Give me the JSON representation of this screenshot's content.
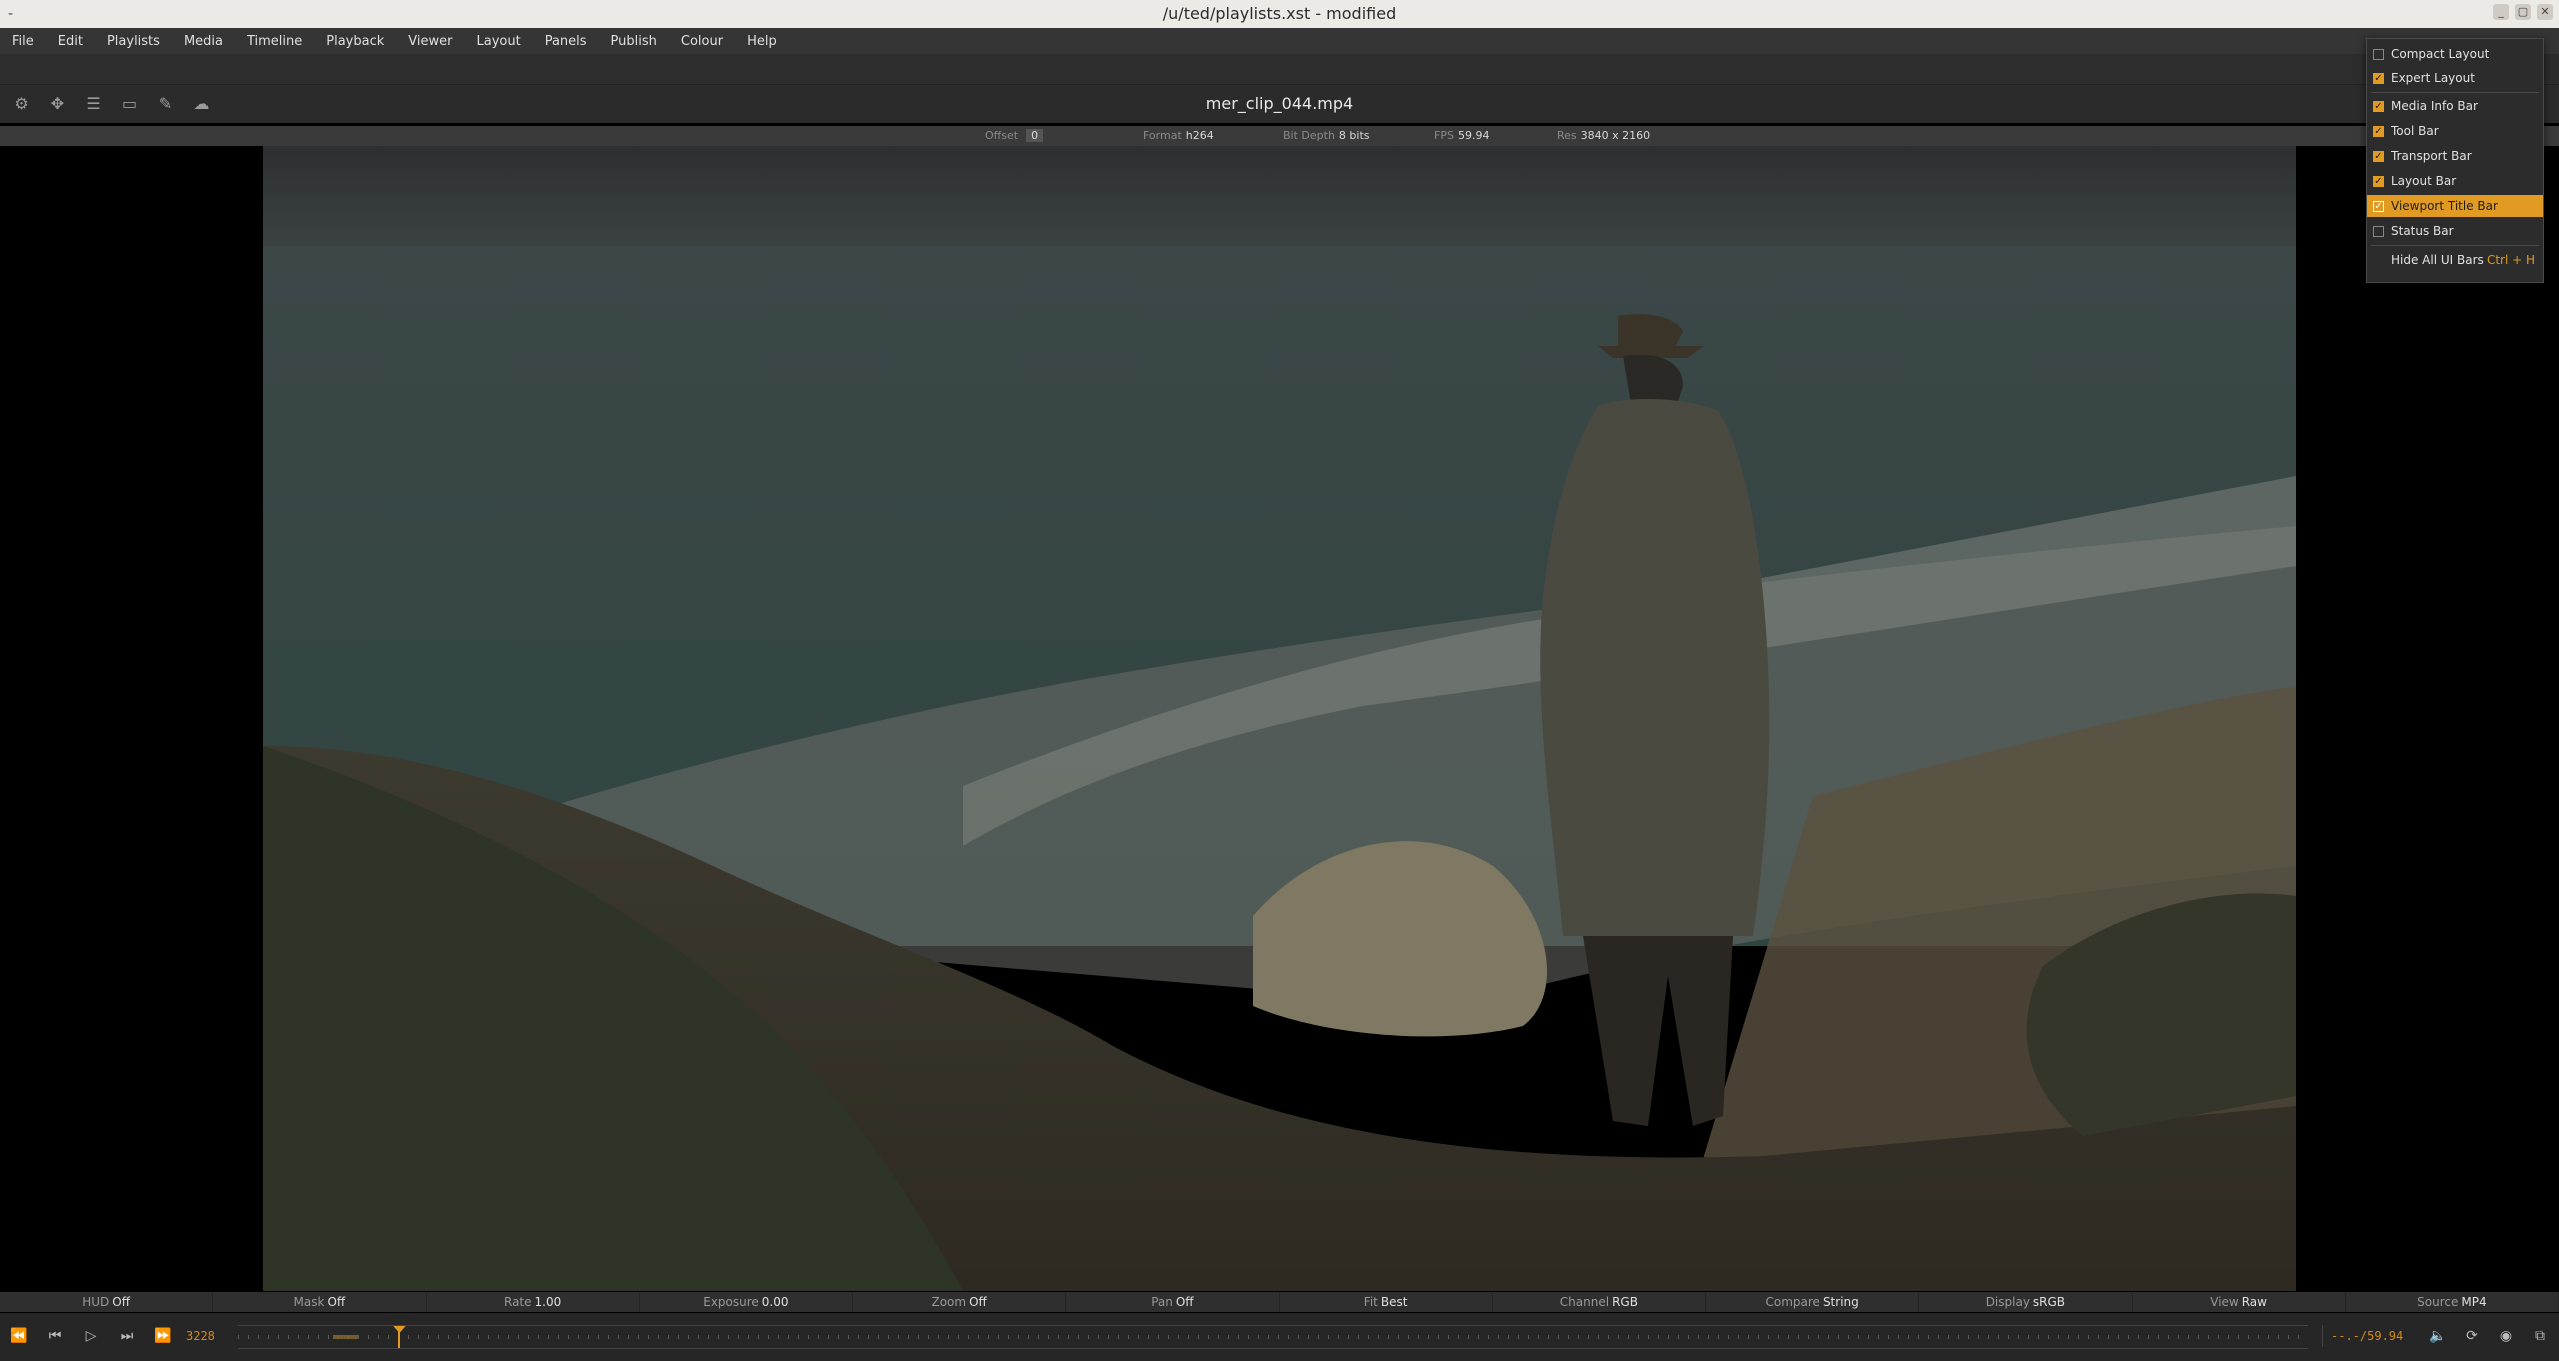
{
  "window": {
    "title": "/u/ted/playlists.xst - modified"
  },
  "menubar": [
    "File",
    "Edit",
    "Playlists",
    "Media",
    "Timeline",
    "Playback",
    "Viewer",
    "Layout",
    "Panels",
    "Publish",
    "Colour",
    "Help"
  ],
  "viewer": {
    "clip_title": "mer_clip_044.mp4",
    "info": {
      "offset_label": "Offset",
      "offset_value": "0",
      "format_label": "Format",
      "format_value": "h264",
      "bitdepth_label": "Bit Depth",
      "bitdepth_value": "8 bits",
      "fps_label": "FPS",
      "fps_value": "59.94",
      "res_label": "Res",
      "res_value": "3840 x 2160"
    }
  },
  "status": [
    {
      "label": "HUD",
      "value": "Off"
    },
    {
      "label": "Mask",
      "value": "Off"
    },
    {
      "label": "Rate",
      "value": "1.00"
    },
    {
      "label": "Exposure",
      "value": "0.00"
    },
    {
      "label": "Zoom",
      "value": "Off"
    },
    {
      "label": "Pan",
      "value": "Off"
    },
    {
      "label": "Fit",
      "value": "Best"
    },
    {
      "label": "Channel",
      "value": "RGB"
    },
    {
      "label": "Compare",
      "value": "String"
    },
    {
      "label": "Display",
      "value": "sRGB"
    },
    {
      "label": "View",
      "value": "Raw"
    },
    {
      "label": "Source",
      "value": "MP4"
    }
  ],
  "transport": {
    "current_frame": "3228",
    "time_readout": "--.-/59.94",
    "playhead_fraction": 0.078
  },
  "layout_menu": {
    "items": [
      {
        "label": "Compact Layout",
        "checked": false
      },
      {
        "label": "Expert Layout",
        "checked": true
      },
      {
        "label": "Media Info Bar",
        "checked": true
      },
      {
        "label": "Tool Bar",
        "checked": true
      },
      {
        "label": "Transport Bar",
        "checked": true
      },
      {
        "label": "Layout Bar",
        "checked": true
      },
      {
        "label": "Viewport Title Bar",
        "checked": true,
        "highlighted": true
      },
      {
        "label": "Status Bar",
        "checked": false
      }
    ],
    "hide_all_label": "Hide All UI Bars",
    "hide_all_shortcut": "Ctrl + H"
  },
  "colors": {
    "accent": "#e19a22",
    "panel": "#2b2b2b"
  }
}
